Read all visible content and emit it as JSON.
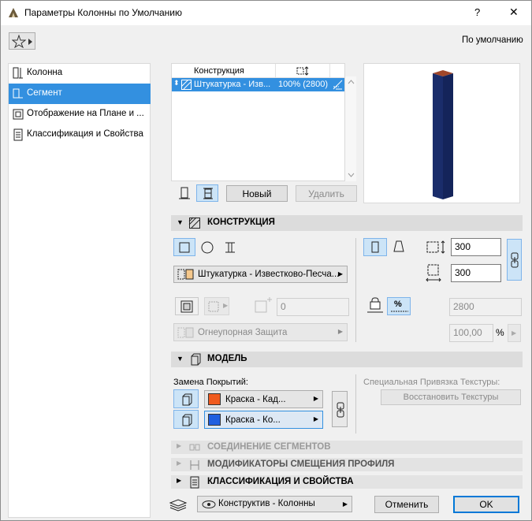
{
  "window": {
    "title": "Параметры Колонны по Умолчанию",
    "help_label": "?",
    "close_label": "✕"
  },
  "header": {
    "favorites_label": "★",
    "default_label": "По умолчанию"
  },
  "sidebar": {
    "items": [
      {
        "label": "Колонна",
        "icon": "column-icon",
        "selected": false
      },
      {
        "label": "Сегмент",
        "icon": "segment-icon",
        "selected": true
      },
      {
        "label": "Отображение на Плане и ...",
        "icon": "floorplan-icon",
        "selected": false
      },
      {
        "label": "Классификация и Свойства",
        "icon": "classification-icon",
        "selected": false
      }
    ]
  },
  "segment_table": {
    "columns": [
      "Конструкция",
      ""
    ],
    "rows": [
      {
        "construction": "Штукатурка - Изв...",
        "length": "100% (2800)",
        "selected": true
      }
    ]
  },
  "segment_buttons": {
    "new_label": "Новый",
    "delete_label": "Удалить"
  },
  "construction_section": {
    "title": "КОНСТРУКЦИЯ",
    "material_label": "Штукатурка - Известково-Песча...",
    "count_value": "0",
    "fire_protection_label": "Огнеупорная Защита",
    "width_value": "300",
    "depth_value": "300",
    "height_value": "2800",
    "percent_value": "100,00",
    "percent_unit": "%"
  },
  "model_section": {
    "title": "МОДЕЛЬ",
    "override_label": "Замена Покрытий:",
    "surface1_label": "Краска - Кад...",
    "surface1_color": "#f05a1e",
    "surface2_label": "Краска - Ко...",
    "surface2_color": "#1f5fe0",
    "texture_label": "Специальная Привязка Текстуры:",
    "restore_textures_label": "Восстановить Текстуры"
  },
  "collapsed_sections": {
    "segment_connection": "СОЕДИНЕНИЕ СЕГМЕНТОВ",
    "profile_modifiers": "МОДИФИКАТОРЫ СМЕЩЕНИЯ ПРОФИЛЯ",
    "classification": "КЛАССИФИКАЦИЯ И СВОЙСТВА"
  },
  "footer": {
    "layer_label": "Конструктив - Колонны",
    "cancel_label": "Отменить",
    "ok_label": "OK"
  },
  "preview": {
    "column_color": "#1a2d6b",
    "cap_color": "#a0472a"
  }
}
